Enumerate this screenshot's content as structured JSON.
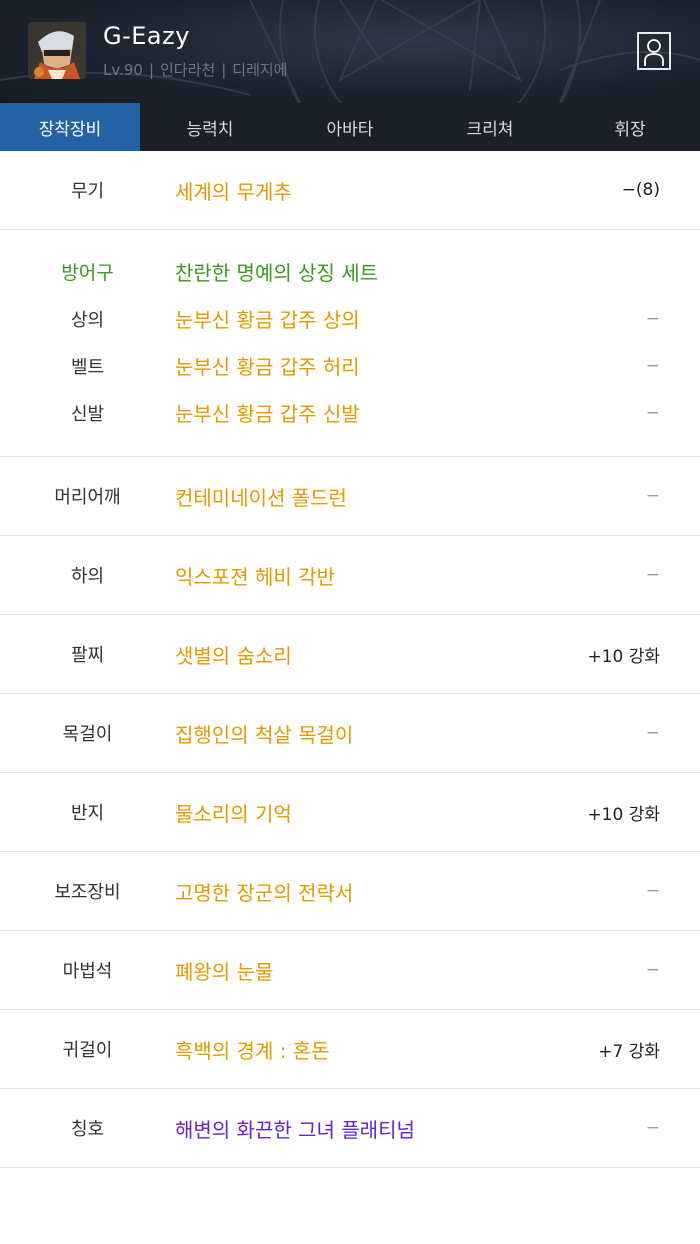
{
  "header": {
    "character_name": "G-Eazy",
    "level": "Lv.90",
    "class": "인다라천",
    "server": "디레지에",
    "separator": "|",
    "avatar_icon": "character-portrait",
    "profile_icon": "person-icon"
  },
  "tabs": [
    {
      "label": "장착장비",
      "active": true
    },
    {
      "label": "능력치",
      "active": false
    },
    {
      "label": "아바타",
      "active": false
    },
    {
      "label": "크리쳐",
      "active": false
    },
    {
      "label": "휘장",
      "active": false
    }
  ],
  "colors": {
    "header_bg": "#1e2430",
    "tab_active": "#2462a6",
    "item_gold": "#e29a00",
    "set_green": "#3a9a1f",
    "title_purple": "#6a22c9"
  },
  "equipment": {
    "weapon": {
      "slot": "무기",
      "name": "세계의 무게추",
      "enhance": "−(8)"
    },
    "armor_set": {
      "slot": "방어구",
      "set_name": "찬란한 명예의 상징 세트",
      "pieces": [
        {
          "slot": "상의",
          "name": "눈부신 황금 갑주 상의",
          "enhance": "−"
        },
        {
          "slot": "벨트",
          "name": "눈부신 황금 갑주 허리",
          "enhance": "−"
        },
        {
          "slot": "신발",
          "name": "눈부신 황금 갑주 신발",
          "enhance": "−"
        }
      ]
    },
    "others": [
      {
        "slot": "머리어깨",
        "name": "컨테미네이션 폴드런",
        "enhance": "−"
      },
      {
        "slot": "하의",
        "name": "익스포젼 헤비 각반",
        "enhance": "−"
      },
      {
        "slot": "팔찌",
        "name": "샛별의 숨소리",
        "enhance": "+10 강화"
      },
      {
        "slot": "목걸이",
        "name": "집행인의 척살 목걸이",
        "enhance": "−"
      },
      {
        "slot": "반지",
        "name": "물소리의 기억",
        "enhance": "+10 강화"
      },
      {
        "slot": "보조장비",
        "name": "고명한 장군의 전략서",
        "enhance": "−"
      },
      {
        "slot": "마법석",
        "name": "폐왕의 눈물",
        "enhance": "−"
      },
      {
        "slot": "귀걸이",
        "name": "흑백의 경계 : 혼돈",
        "enhance": "+7 강화"
      },
      {
        "slot": "칭호",
        "name": "해변의 화끈한 그녀 플래티넘",
        "enhance": "−"
      }
    ]
  }
}
